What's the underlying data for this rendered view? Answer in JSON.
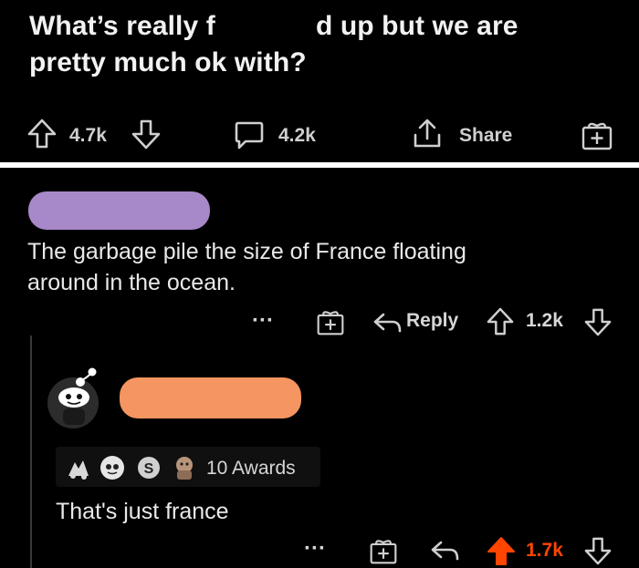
{
  "post": {
    "title_part1": "What’s really f",
    "title_part2": "d up but we are",
    "title_line2": "pretty much ok with?",
    "upvotes": "4.7k",
    "comments": "4.2k",
    "share_label": "Share"
  },
  "comment": {
    "body": [
      "The garbage pile the size of France floating",
      "around in the ocean."
    ],
    "more_label": "···",
    "reply_label": "Reply",
    "score": "1.2k"
  },
  "reply": {
    "awards_label": "10 Awards",
    "body": "That's just france",
    "more_label": "···",
    "score": "1.7k"
  },
  "colors": {
    "background": "#000000",
    "username_redaction_1": "#a788c8",
    "username_redaction_2": "#f59561",
    "upvote_active": "#ff4500"
  }
}
